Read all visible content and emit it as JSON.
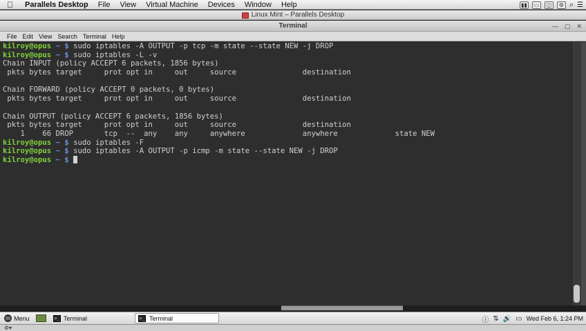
{
  "mac_menubar": {
    "apple_icon": "apple-logo-icon",
    "app_name": "Parallels Desktop",
    "items": [
      "File",
      "View",
      "Virtual Machine",
      "Devices",
      "Window",
      "Help"
    ]
  },
  "vm_titlebar": {
    "title": "Linux Mint – Parallels Desktop"
  },
  "terminal_window": {
    "title": "Terminal",
    "controls": [
      "—",
      "▢",
      "✕"
    ]
  },
  "terminal_menu": [
    "File",
    "Edit",
    "View",
    "Search",
    "Terminal",
    "Help"
  ],
  "terminal": {
    "prompt_user": "kilroy@opus",
    "prompt_path": " ~ $",
    "lines": [
      {
        "type": "cmd",
        "text": " sudo iptables -A OUTPUT -p tcp -m state --state NEW -j DROP"
      },
      {
        "type": "cmd",
        "text": " sudo iptables -L -v"
      },
      {
        "type": "out",
        "text": "Chain INPUT (policy ACCEPT 6 packets, 1856 bytes)"
      },
      {
        "type": "out",
        "text": " pkts bytes target     prot opt in     out     source               destination"
      },
      {
        "type": "out",
        "text": ""
      },
      {
        "type": "out",
        "text": "Chain FORWARD (policy ACCEPT 0 packets, 0 bytes)"
      },
      {
        "type": "out",
        "text": " pkts bytes target     prot opt in     out     source               destination"
      },
      {
        "type": "out",
        "text": ""
      },
      {
        "type": "out",
        "text": "Chain OUTPUT (policy ACCEPT 6 packets, 1856 bytes)"
      },
      {
        "type": "out",
        "text": " pkts bytes target     prot opt in     out     source               destination"
      },
      {
        "type": "out",
        "text": "    1    66 DROP       tcp  --  any    any     anywhere             anywhere             state NEW"
      },
      {
        "type": "cmd",
        "text": " sudo iptables -F"
      },
      {
        "type": "cmd",
        "text": " sudo iptables -A OUTPUT -p icmp -m state --state NEW -j DROP"
      },
      {
        "type": "cmd",
        "text": " "
      }
    ]
  },
  "panel": {
    "menu_label": "Menu",
    "launcher_label": "Terminal",
    "task_label": "Terminal",
    "clock": "Wed Feb  6,  1:24 PM"
  }
}
